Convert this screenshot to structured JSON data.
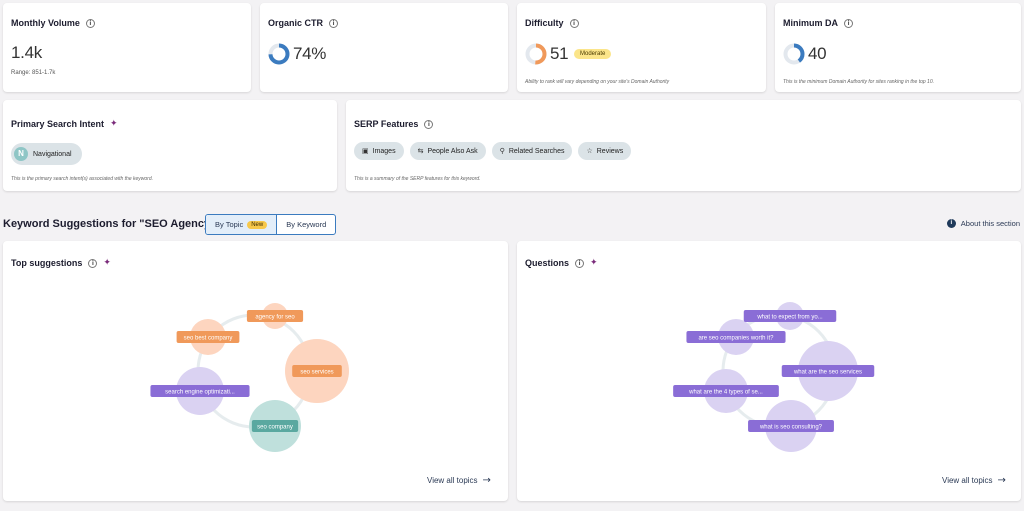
{
  "metrics": {
    "volume": {
      "title": "Monthly Volume",
      "value": "1.4k",
      "range": "Range: 851-1.7k"
    },
    "ctr": {
      "title": "Organic CTR",
      "value": "74%",
      "fraction": 0.74,
      "color": "#3b7bbf"
    },
    "difficulty": {
      "title": "Difficulty",
      "value": "51",
      "badge": "Moderate",
      "fraction": 0.51,
      "color": "#f0995a",
      "note": "Ability to rank will vary depending on your site's Domain Authority"
    },
    "min_da": {
      "title": "Minimum DA",
      "value": "40",
      "fraction": 0.4,
      "color": "#3b7bbf",
      "note": "This is the minimum Domain Authority for sites ranking in the top 10."
    }
  },
  "intent": {
    "title": "Primary Search Intent",
    "letter": "N",
    "label": "Navigational",
    "note": "This is the primary search intent(s) associated with the keyword."
  },
  "serp": {
    "title": "SERP Features",
    "chips": [
      {
        "label": "Images",
        "icon": "image-icon"
      },
      {
        "label": "People Also Ask",
        "icon": "qa-icon"
      },
      {
        "label": "Related Searches",
        "icon": "related-icon"
      },
      {
        "label": "Reviews",
        "icon": "star-icon"
      }
    ],
    "note": "This is a summary of the SERP features for this keyword."
  },
  "suggestions": {
    "title": "Keyword Suggestions for \"SEO Agency\"",
    "toggle": {
      "by_topic": "By Topic",
      "new_badge": "New",
      "by_keyword": "By Keyword"
    },
    "about": "About this section"
  },
  "top_suggestions": {
    "title": "Top suggestions",
    "view_all": "View all topics",
    "bubbles": [
      {
        "label": "agency for seo",
        "r": 13,
        "fill": "#fdd5bf",
        "tag": "#f0995a"
      },
      {
        "label": "seo best company",
        "r": 18,
        "fill": "#fdd5bf",
        "tag": "#f0995a"
      },
      {
        "label": "seo services",
        "r": 32,
        "fill": "#fdd5bf",
        "tag": "#f0995a"
      },
      {
        "label": "search engine optimizati...",
        "r": 24,
        "fill": "#dad2f2",
        "tag": "#8a6dd6"
      },
      {
        "label": "seo company",
        "r": 26,
        "fill": "#bfe0dc",
        "tag": "#5aa8a0"
      }
    ]
  },
  "questions": {
    "title": "Questions",
    "view_all": "View all topics",
    "bubbles": [
      {
        "label": "what to expect from yo...",
        "r": 14,
        "fill": "#dad2f2",
        "tag": "#8a6dd6"
      },
      {
        "label": "are seo companies worth it?",
        "r": 18,
        "fill": "#dad2f2",
        "tag": "#8a6dd6"
      },
      {
        "label": "what are the seo services",
        "r": 30,
        "fill": "#dad2f2",
        "tag": "#8a6dd6"
      },
      {
        "label": "what are the 4 types of se...",
        "r": 22,
        "fill": "#dad2f2",
        "tag": "#8a6dd6"
      },
      {
        "label": "what is seo consulting?",
        "r": 26,
        "fill": "#dad2f2",
        "tag": "#8a6dd6"
      }
    ]
  }
}
